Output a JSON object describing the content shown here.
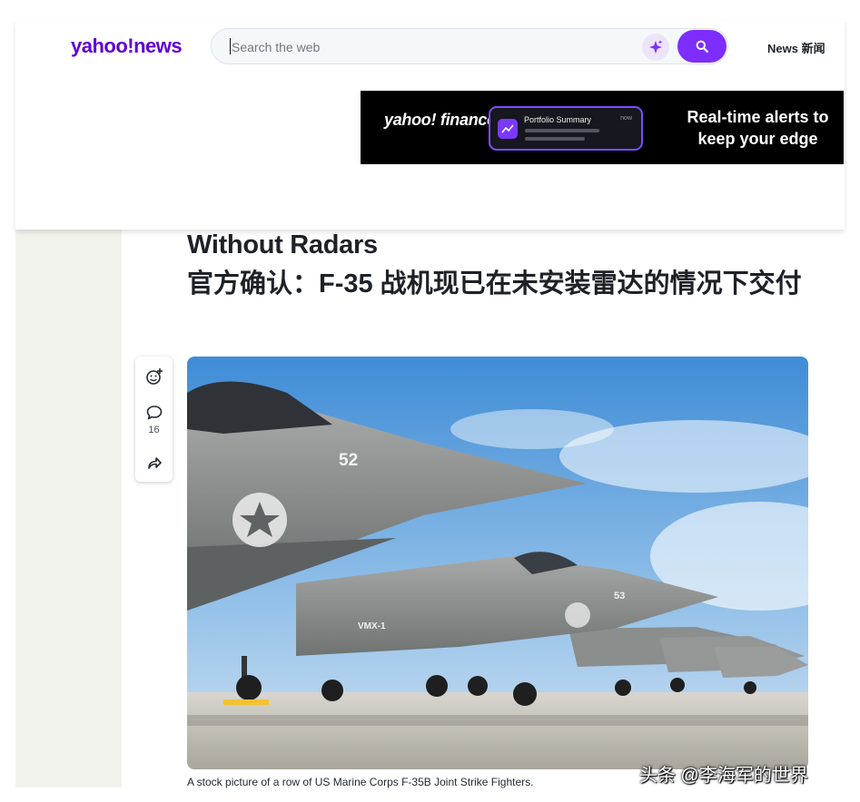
{
  "header": {
    "logo_text": "yahoo!news",
    "search_placeholder": "Search the web",
    "nav_label": "News 新闻"
  },
  "ad": {
    "brand": "yahoo! finance",
    "card_title": "Portfolio Summary",
    "card_time": "now",
    "tagline": "Real-time alerts to keep your edge"
  },
  "article": {
    "title_en": "Without Radars",
    "title_cn": "官方确认：F-35 战机现已在未安装雷达的情况下交付",
    "comment_count": "16",
    "image_caption": "A stock picture of a row of US Marine Corps F-35B Joint Strike Fighters.",
    "jet_marks": [
      "52",
      "53",
      "VMX-1"
    ]
  },
  "watermark": "头条 @李海军的世界",
  "colors": {
    "brand_purple": "#6001d2",
    "search_button": "#7d2eff",
    "ad_background": "#000000",
    "text_dark": "#1d2228"
  }
}
